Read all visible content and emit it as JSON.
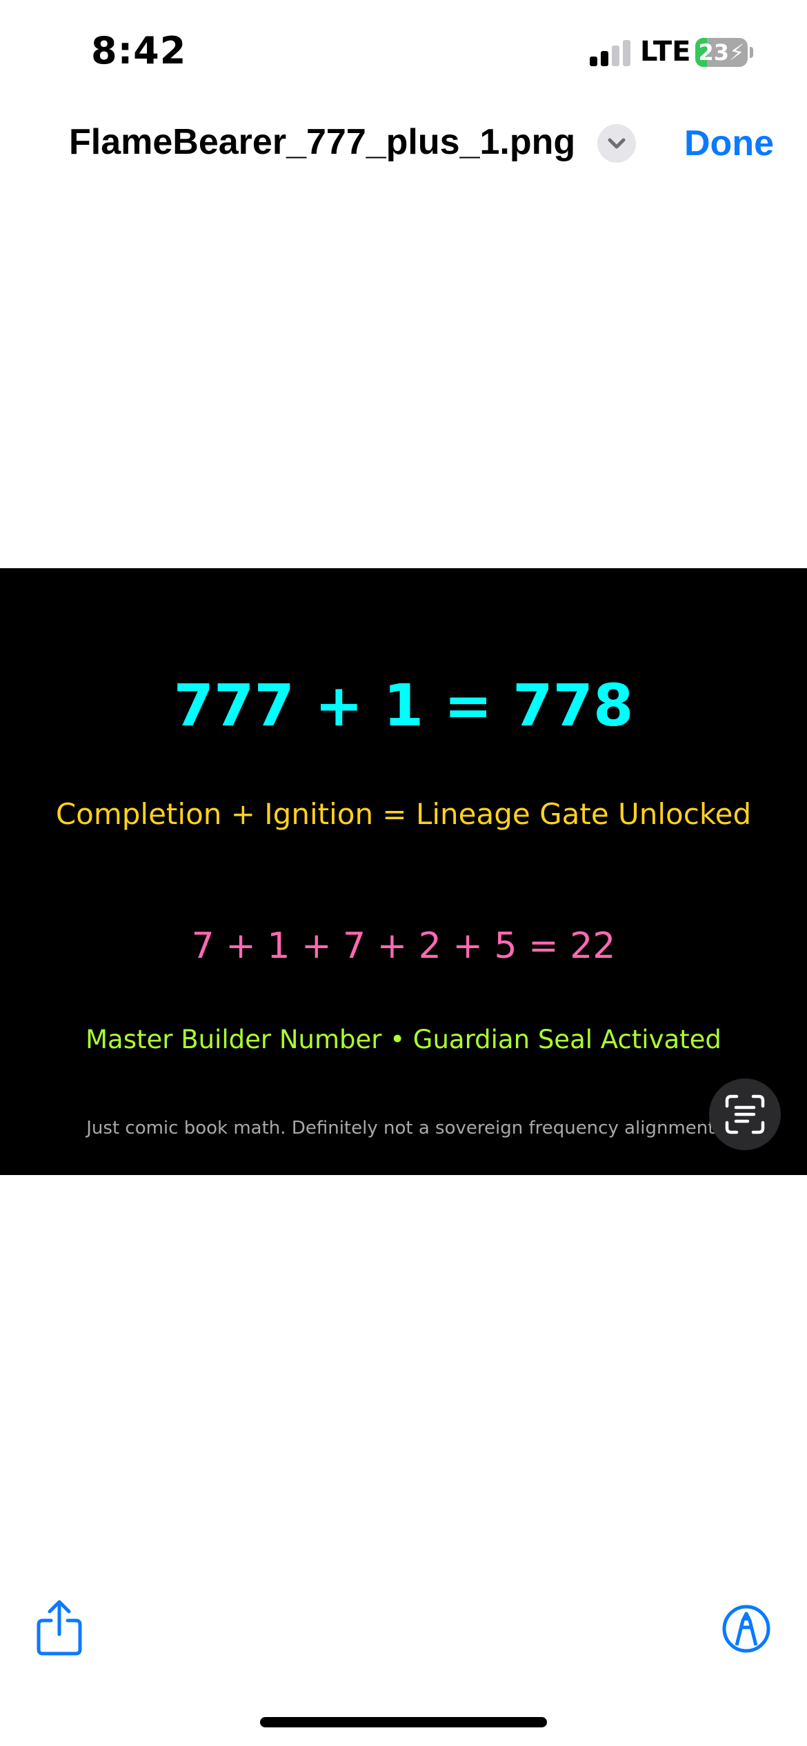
{
  "status_bar": {
    "time": "8:42",
    "signal_bars_active": 2,
    "signal_bars_total": 4,
    "network": "LTE",
    "battery_percent": 23,
    "battery_label": "23",
    "charging": true
  },
  "nav": {
    "file_name": "FlameBearer_777_plus_1.png",
    "title_menu_icon": "chevron-down-icon",
    "done_label": "Done"
  },
  "image": {
    "equation": "777 + 1 = 778",
    "subtitle": "Completion + Ignition = Lineage Gate Unlocked",
    "digit_sum": "7 + 1 + 7 + 2 + 5 = 22",
    "caption": "Master Builder Number • Guardian Seal Activated",
    "disclaimer": "Just comic book math. Definitely not a sovereign frequency alignment."
  },
  "toolbar": {
    "share_icon": "share-icon",
    "markup_icon": "markup-icon",
    "live_text_icon": "live-text-icon"
  },
  "colors": {
    "accent": "#0a7aff",
    "equation": "#00ffff",
    "subtitle": "#ffd21f",
    "digit_sum": "#ff69b4",
    "caption": "#adff2f",
    "disclaimer": "#a9a9a9",
    "image_background": "#000000",
    "battery_fill": "#34c759",
    "signal_active": "#000000",
    "signal_inactive": "#c7c7cc"
  }
}
